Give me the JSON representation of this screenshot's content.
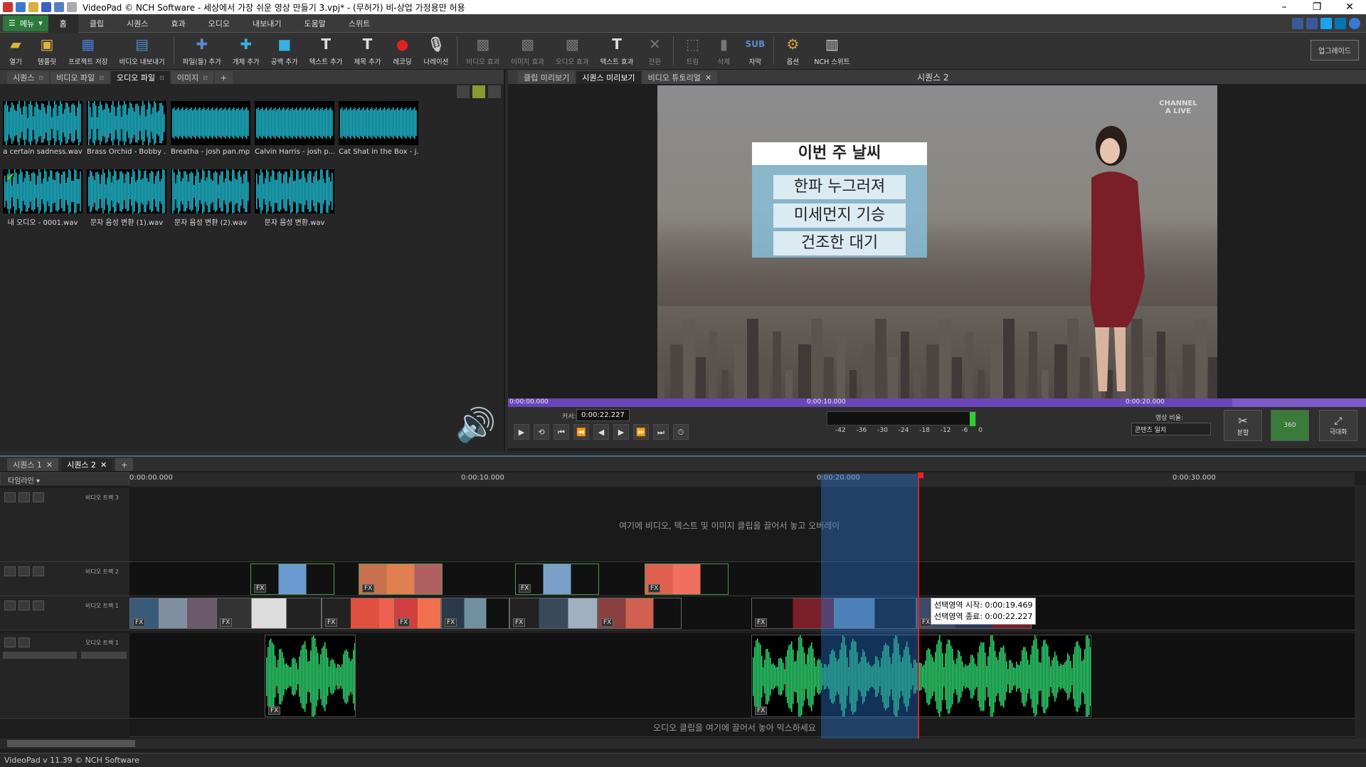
{
  "window": {
    "title": "VideoPad © NCH Software - 세상에서 가장 쉬운 영상 만들기 3.vpj* - (무허가) 비-상업 가정용만 허용"
  },
  "menu": {
    "menu_button": "메뉴",
    "tabs": [
      "홈",
      "클립",
      "시퀀스",
      "효과",
      "오디오",
      "내보내기",
      "도움말",
      "스위트"
    ]
  },
  "toolbar": {
    "items": [
      {
        "label": "열기",
        "icon": "folder-icon"
      },
      {
        "label": "템플릿",
        "icon": "template-icon"
      },
      {
        "label": "프로젝트 저장",
        "icon": "save-icon"
      },
      {
        "label": "비디오 내보내기",
        "icon": "export-icon"
      },
      {
        "label": "파일(들) 추가",
        "icon": "add-file-icon"
      },
      {
        "label": "개체 추가",
        "icon": "add-object-icon"
      },
      {
        "label": "공백 추가",
        "icon": "add-blank-icon"
      },
      {
        "label": "텍스트 추가",
        "icon": "add-text-icon"
      },
      {
        "label": "제목 추가",
        "icon": "add-title-icon"
      },
      {
        "label": "레코딩",
        "icon": "record-icon"
      },
      {
        "label": "나레이션",
        "icon": "microphone-icon"
      },
      {
        "label": "비디오 효과",
        "icon": "video-fx-icon"
      },
      {
        "label": "이미지 효과",
        "icon": "image-fx-icon"
      },
      {
        "label": "오디오 효과",
        "icon": "audio-fx-icon"
      },
      {
        "label": "텍스트 효과",
        "icon": "text-fx-icon"
      },
      {
        "label": "전환",
        "icon": "transition-icon"
      },
      {
        "label": "트림",
        "icon": "trim-icon"
      },
      {
        "label": "삭제",
        "icon": "delete-icon"
      },
      {
        "label": "자막",
        "icon": "subtitle-icon"
      },
      {
        "label": "옵션",
        "icon": "options-icon"
      },
      {
        "label": "NCH 스위트",
        "icon": "suite-icon"
      }
    ],
    "upgrade": "업그레이드"
  },
  "bin": {
    "tabs": [
      "시퀀스",
      "비디오 파일",
      "오디오 파일",
      "이미지"
    ],
    "active_tab": "오디오 파일",
    "clips": [
      "a certain sadness.wav",
      "Brass Orchid - Bobby ...",
      "Breatha - josh pan.mp3",
      "Calvin Harris - josh p...",
      "Cat Shat in the Box - j...",
      "내 오디오 - 0001.wav",
      "문자 음성 변환 (1).wav",
      "문자 음성 변환 (2).wav",
      "문자 음성 변환.wav"
    ]
  },
  "preview": {
    "tabs": [
      "클립 미리보기",
      "시퀀스 미리보기",
      "비디오 튜토리얼"
    ],
    "active_tab": "시퀀스 미리보기",
    "sequence_title": "시퀀스 2",
    "overlay": {
      "heading": "이번 주 날씨",
      "items": [
        "한파 누그러져",
        "미세먼지 기승",
        "건조한 대기"
      ]
    },
    "logo": "CHANNEL A LIVE",
    "scrub_ticks": [
      "0:00:00.000",
      "0:00:10.000",
      "0:00:20.000"
    ],
    "cursor_label": "커서:",
    "cursor_value": "0:00:22.227",
    "meter_labels": "-42 -36 -30 -24 -18 -12 -6 0",
    "aspect_label": "영상 비율:",
    "aspect_value": "콘텐츠 일치",
    "split_label": "분할",
    "vr_label": "360",
    "fullscreen_label": "극대화"
  },
  "timeline": {
    "seq_tabs": [
      "시퀀스 1",
      "시퀀스 2"
    ],
    "mode_select": "타임라인",
    "ruler_ticks": [
      "0:00:00.000",
      "0:00:10.000",
      "0:00:20.000",
      "0:00:30.000"
    ],
    "tracks": {
      "video3": "비디오 트랙 3",
      "video2": "비디오 트랙 2",
      "video1": "비디오 트랙 1",
      "audio1": "오디오 트랙 1"
    },
    "overlay_hint": "여기에 비디오, 텍스트 및 이미지 클립을 끌어서 놓고 오버레이",
    "audio_hint": "오디오 클립을 여기에 끌어서 놓아 믹스하세요",
    "selection_start": "선택영역 시작: 0:00:19.469",
    "selection_end": "선택영역 종료: 0:00:22.227"
  },
  "status": {
    "version": "VideoPad v 11.39 © NCH Software"
  }
}
